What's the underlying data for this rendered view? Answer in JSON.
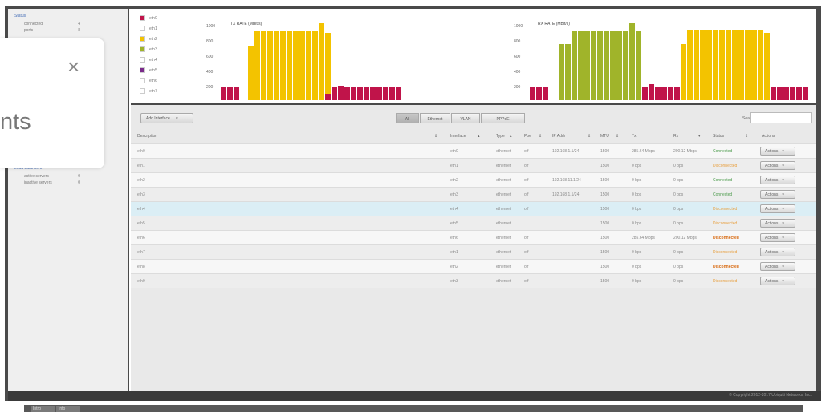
{
  "sidebar": {
    "top_link": "Status",
    "summary": [
      {
        "label": "connected",
        "count": "4"
      },
      {
        "label": "ports",
        "count": "8"
      }
    ],
    "bottom_link": "Load balancers",
    "bottom_items": [
      {
        "label": "active servers",
        "count": "0"
      },
      {
        "label": "inactive servers",
        "count": "0"
      }
    ]
  },
  "popup": {
    "close_glyph": "×",
    "partial_text": "nts"
  },
  "legend": [
    {
      "label": "eth0",
      "color": "#c0144a"
    },
    {
      "label": "eth1",
      "color": "#ffffff"
    },
    {
      "label": "eth2",
      "color": "#f3c300"
    },
    {
      "label": "eth3",
      "color": "#a0b42a"
    },
    {
      "label": "eth4",
      "color": "#ffffff"
    },
    {
      "label": "eth5",
      "color": "#7a2a8a"
    },
    {
      "label": "eth6",
      "color": "#ffffff"
    },
    {
      "label": "eth7",
      "color": "#ffffff"
    }
  ],
  "charts": [
    {
      "title": "TX RATE (MBit/s)",
      "ticks": [
        "1000",
        "800",
        "600",
        "400",
        "200"
      ]
    },
    {
      "title": "RX RATE (MBit/s)",
      "ticks": [
        "1000",
        "800",
        "600",
        "400",
        "200"
      ]
    }
  ],
  "toolbar": {
    "add_label": "Add Interface",
    "add_caret": "▾",
    "filters": [
      "All",
      "Ethernet",
      "VLAN",
      "PPPoE"
    ],
    "search_label": "Search:",
    "search_value": ""
  },
  "table": {
    "headers": [
      "Description",
      "Interface",
      "Type",
      "Poe",
      "IP Addr",
      "MTU",
      "Tx",
      "Rx",
      "Status",
      "Actions"
    ],
    "rows": [
      {
        "desc": "eth0",
        "iface": "eth0",
        "type": "ethernet",
        "poe": "off",
        "ip": "192.168.1.1/24",
        "mtu": "1500",
        "tx": "285.64 Mbps",
        "rx": "200.12 Mbps",
        "status": "Connected",
        "status_kind": "conn"
      },
      {
        "desc": "eth1",
        "iface": "eth1",
        "type": "ethernet",
        "poe": "off",
        "ip": "",
        "mtu": "1500",
        "tx": "0 bps",
        "rx": "0 bps",
        "status": "Disconnected",
        "status_kind": "disc"
      },
      {
        "desc": "eth2",
        "iface": "eth2",
        "type": "ethernet",
        "poe": "off",
        "ip": "192.168.11.1/24",
        "mtu": "1500",
        "tx": "0 bps",
        "rx": "0 bps",
        "status": "Connected",
        "status_kind": "conn"
      },
      {
        "desc": "eth3",
        "iface": "eth3",
        "type": "ethernet",
        "poe": "off",
        "ip": "192.168.1.1/24",
        "mtu": "1500",
        "tx": "0 bps",
        "rx": "0 bps",
        "status": "Connected",
        "status_kind": "conn"
      },
      {
        "desc": "eth4",
        "iface": "eth4",
        "type": "ethernet",
        "poe": "off",
        "ip": "",
        "mtu": "1500",
        "tx": "0 bps",
        "rx": "0 bps",
        "status": "Disconnected",
        "status_kind": "disc"
      },
      {
        "desc": "eth5",
        "iface": "eth5",
        "type": "ethernet",
        "poe": "",
        "ip": "",
        "mtu": "1500",
        "tx": "0 bps",
        "rx": "0 bps",
        "status": "Disconnected",
        "status_kind": "disc"
      },
      {
        "desc": "eth6",
        "iface": "eth6",
        "type": "ethernet",
        "poe": "off",
        "ip": "",
        "mtu": "1500",
        "tx": "285.64 Mbps",
        "rx": "200.12 Mbps",
        "status": "Disconnected",
        "status_kind": "disc-bold"
      },
      {
        "desc": "eth7",
        "iface": "eth1",
        "type": "ethernet",
        "poe": "off",
        "ip": "",
        "mtu": "1500",
        "tx": "0 bps",
        "rx": "0 bps",
        "status": "Disconnected",
        "status_kind": "disc"
      },
      {
        "desc": "eth8",
        "iface": "eth2",
        "type": "ethernet",
        "poe": "off",
        "ip": "",
        "mtu": "1500",
        "tx": "0 bps",
        "rx": "0 bps",
        "status": "Disconnected",
        "status_kind": "disc-bold"
      },
      {
        "desc": "eth9",
        "iface": "eth3",
        "type": "ethernet",
        "poe": "off",
        "ip": "",
        "mtu": "1500",
        "tx": "0 bps",
        "rx": "0 bps",
        "status": "Disconnected",
        "status_kind": "disc"
      }
    ],
    "action_label": "Actions",
    "action_caret": "▾"
  },
  "footer": {
    "copyright": "© Copyright 2012-2017 Ubiquiti Networks, Inc.",
    "taskbar_tabs": [
      "Intro",
      "Info"
    ]
  },
  "colors": {
    "frame": "#4a4a4a",
    "connected": "#4a9a4a",
    "disconnected": "#e8a040",
    "link": "#4a72b8"
  }
}
